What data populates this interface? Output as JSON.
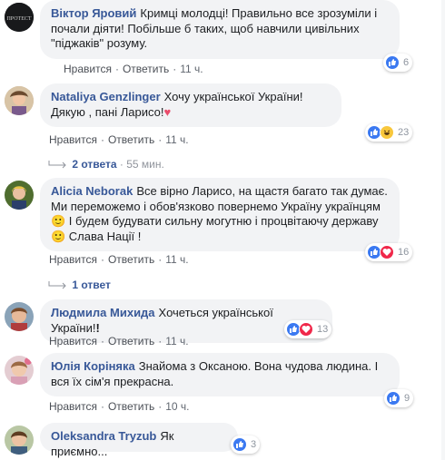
{
  "comments": [
    {
      "name": "Віктор Яровий",
      "text": "Кримці молодці! Правильно все зрозуміли і почали діяти! Побільше б таких, щоб навчили цивільних \"піджаків\" розуму.",
      "like_label": "Нравится",
      "reply_label": "Ответить",
      "time": "11 ч.",
      "reactions": [
        "like"
      ],
      "count": "6"
    },
    {
      "name": "Nataliya Genzlinger",
      "text": "Хочу української України! Дякую , пані Ларисо!",
      "like_label": "Нравится",
      "reply_label": "Ответить",
      "time": "11 ч.",
      "reactions": [
        "like",
        "haha"
      ],
      "count": "23",
      "replies": {
        "label": "2 ответа",
        "time": "55 мин."
      }
    },
    {
      "name": "Alicia Neborak",
      "text": "Все вірно Ларисо, на щастя багато так думає. Ми переможемо і обов'язково повернемо Україну українцям 🙂 І будем будувати сильну могутню і процвітаючу державу 🙂 Слава Нації !",
      "like_label": "Нравится",
      "reply_label": "Ответить",
      "time": "11 ч.",
      "reactions": [
        "like",
        "love"
      ],
      "count": "16",
      "replies": {
        "label": "1 ответ",
        "time": ""
      }
    },
    {
      "name": "Людмила Михида",
      "text": "Хочеться української України!",
      "like_label": "Нравится",
      "reply_label": "Ответить",
      "time": "11 ч.",
      "reactions": [
        "like",
        "love"
      ],
      "count": "13"
    },
    {
      "name": "Юлія Коріняка",
      "text": "Знайома з Оксаною. Вона чудова людина. І вся їх сім'я прекрасна.",
      "like_label": "Нравится",
      "reply_label": "Ответить",
      "time": "10 ч.",
      "reactions": [
        "like"
      ],
      "count": "9"
    },
    {
      "name": "Oleksandra Tryzub",
      "text": "Як приємно...",
      "reactions": [
        "like"
      ],
      "count": "3"
    }
  ],
  "colors": {
    "name": "#385898",
    "bubble": "#f2f3f5",
    "like": "#3b79f1",
    "love": "#f0284a",
    "haha": "#f8c73c"
  }
}
